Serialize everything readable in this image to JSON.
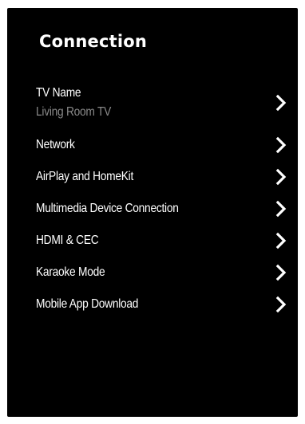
{
  "panel": {
    "title": "Connection",
    "background_color": "#000000",
    "text_color": "#ffffff",
    "secondary_text_color": "#8a8a8a"
  },
  "menu": {
    "items": [
      {
        "label": "TV Name",
        "value": "Living Room TV",
        "icon": "chevron-right-icon"
      },
      {
        "label": "Network",
        "icon": "chevron-right-icon"
      },
      {
        "label": "AirPlay and HomeKit",
        "icon": "chevron-right-icon"
      },
      {
        "label": "Multimedia Device Connection",
        "icon": "chevron-right-icon"
      },
      {
        "label": "HDMI & CEC",
        "icon": "chevron-right-icon"
      },
      {
        "label": "Karaoke Mode",
        "icon": "chevron-right-icon"
      },
      {
        "label": "Mobile App Download",
        "icon": "chevron-right-icon"
      }
    ]
  }
}
